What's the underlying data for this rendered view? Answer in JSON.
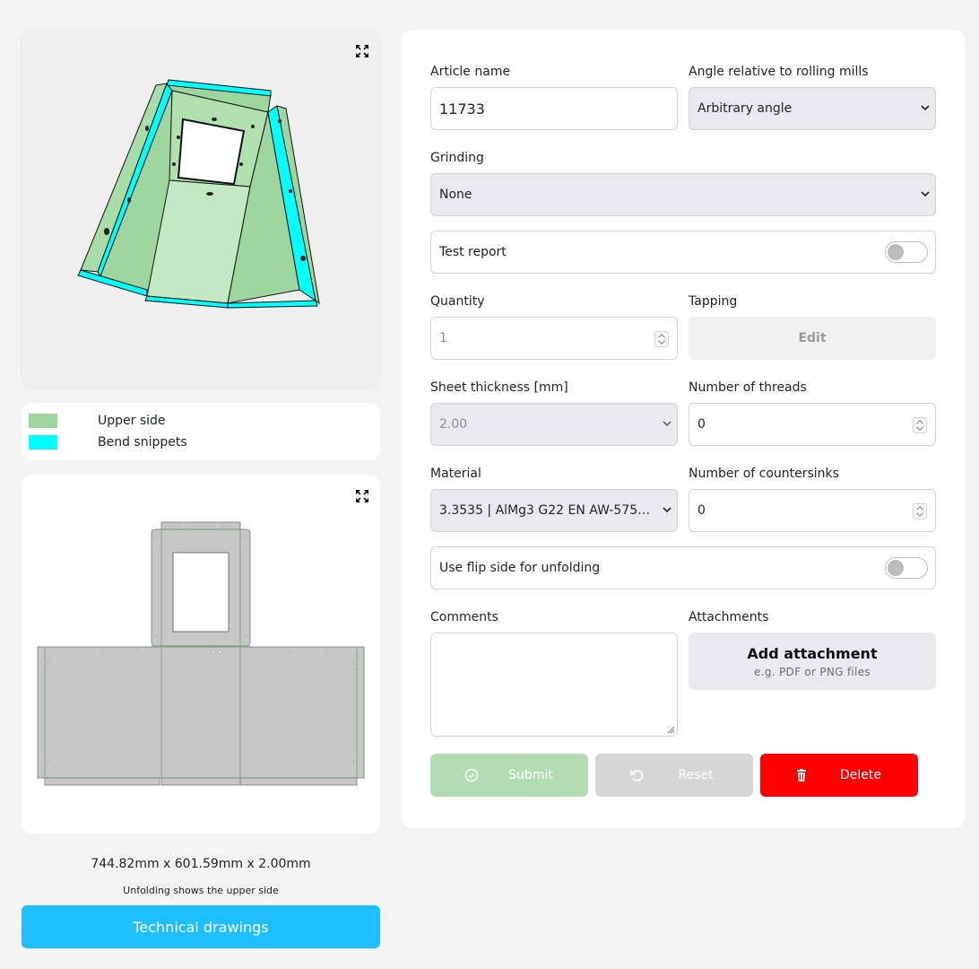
{
  "legend": {
    "items": [
      {
        "label": "Upper side",
        "color": "#9fd6a0"
      },
      {
        "label": "Bend snippets",
        "color": "#00ffff"
      }
    ]
  },
  "dimensions": "744.82mm x 601.59mm x 2.00mm",
  "unfold_note": "Unfolding shows the upper side",
  "technical_drawings_label": "Technical drawings",
  "form": {
    "article_name": {
      "label": "Article name",
      "value": "11733"
    },
    "angle": {
      "label": "Angle relative to rolling mills",
      "value": "Arbitrary angle"
    },
    "grinding": {
      "label": "Grinding",
      "value": "None"
    },
    "test_report": {
      "label": "Test report",
      "checked": false
    },
    "quantity": {
      "label": "Quantity",
      "placeholder": "1"
    },
    "tapping": {
      "label": "Tapping",
      "button": "Edit"
    },
    "sheet_thickness": {
      "label": "Sheet thickness [mm]",
      "value": "2.00"
    },
    "threads": {
      "label": "Number of threads",
      "value": "0"
    },
    "material": {
      "label": "Material",
      "value": "3.3535 | AlMg3 G22 EN AW-5754…"
    },
    "countersinks": {
      "label": "Number of countersinks",
      "value": "0"
    },
    "flip_side": {
      "label": "Use flip side for unfolding",
      "checked": false
    },
    "comments": {
      "label": "Comments",
      "value": ""
    },
    "attachments": {
      "label": "Attachments",
      "button_title": "Add attachment",
      "button_hint": "e.g. PDF or PNG files"
    }
  },
  "actions": {
    "submit": "Submit",
    "reset": "Reset",
    "delete": "Delete"
  },
  "colors": {
    "accent": "#1ebeff",
    "submit_bg": "#b3dcb4",
    "reset_bg": "#d6d6d6",
    "delete_bg": "#ff0000",
    "part_green": "#9fd6a0",
    "bend_cyan": "#00ffff",
    "unfold_gray": "#c7c7c7"
  },
  "icons": {
    "expand": "expand-arrows-icon",
    "chevron": "chevron-down-icon",
    "submit": "check-circle-icon",
    "reset": "undo-icon",
    "delete": "trash-icon"
  }
}
